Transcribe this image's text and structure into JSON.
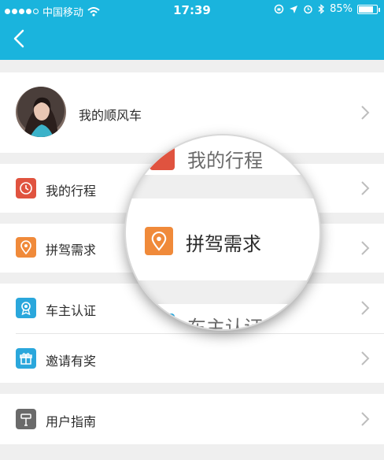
{
  "status": {
    "carrier": "中国移动",
    "time": "17:39",
    "battery": "85%",
    "battery_level": 0.85
  },
  "header": {
    "back_icon": "chevron-left-icon",
    "color": "#1ab4dd"
  },
  "profile": {
    "label": "我的顺风车"
  },
  "menu": [
    {
      "label": "我的行程",
      "icon": "clock-icon",
      "color": "#e0533f"
    },
    {
      "label": "拼驾需求",
      "icon": "location-pin-icon",
      "color": "#f08a3a"
    },
    {
      "label": "车主认证",
      "icon": "badge-icon",
      "color": "#2aa7dc"
    },
    {
      "label": "邀请有奖",
      "icon": "gift-icon",
      "color": "#2aa7dc"
    },
    {
      "label": "用户指南",
      "icon": "signpost-icon",
      "color": "#6a6a6a"
    }
  ],
  "magnifier": {
    "top_text": "我的行程",
    "main_text": "拼驾需求",
    "bottom_text": "车主认证"
  }
}
